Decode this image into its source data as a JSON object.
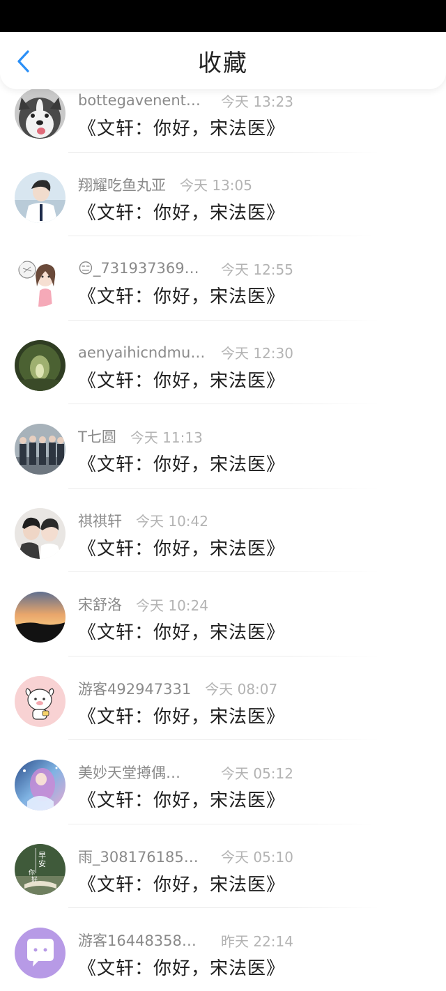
{
  "header": {
    "title": "收藏",
    "back_icon": "chevron-left-icon",
    "accent": "#2a8ff7"
  },
  "items": [
    {
      "username": "bottegavenent…",
      "time": "今天 13:23",
      "message": "《文轩：你好，宋法医》",
      "avatar": "husky-dog-photo"
    },
    {
      "username": "翔耀吃鱼丸亚",
      "time": "今天 13:05",
      "message": "《文轩：你好，宋法医》",
      "avatar": "boy-in-school-uniform-photo"
    },
    {
      "username": "😑_731937369…",
      "time": "今天 12:55",
      "message": "《文轩：你好，宋法医》",
      "avatar": "cartoon-girl-drawing"
    },
    {
      "username": "aenyaihicndmu…",
      "time": "今天 12:30",
      "message": "《文轩：你好，宋法医》",
      "avatar": "forest-tunnel-photo"
    },
    {
      "username": "T七圆",
      "time": "今天 11:13",
      "message": "《文轩：你好，宋法医》",
      "avatar": "group-photo"
    },
    {
      "username": "祺祺轩",
      "time": "今天 10:42",
      "message": "《文轩：你好，宋法医》",
      "avatar": "two-boys-photo"
    },
    {
      "username": "宋舒洛",
      "time": "今天 10:24",
      "message": "《文轩：你好，宋法医》",
      "avatar": "sunset-sky-photo"
    },
    {
      "username": "游客492947331",
      "time": "今天 08:07",
      "message": "《文轩：你好，宋法医》",
      "avatar": "cute-cow-cartoon"
    },
    {
      "username": "美妙天堂撙偶…",
      "time": "今天 05:12",
      "message": "《文轩：你好，宋法医》",
      "avatar": "anime-girl-art"
    },
    {
      "username": "雨_308176185…",
      "time": "今天 05:10",
      "message": "《文轩：你好，宋法医》",
      "avatar": "早安你好-book-photo"
    },
    {
      "username": "游客16448358…",
      "time": "昨天 22:14",
      "message": "《文轩：你好，宋法医》",
      "avatar": "chat-bubble-icon"
    }
  ]
}
